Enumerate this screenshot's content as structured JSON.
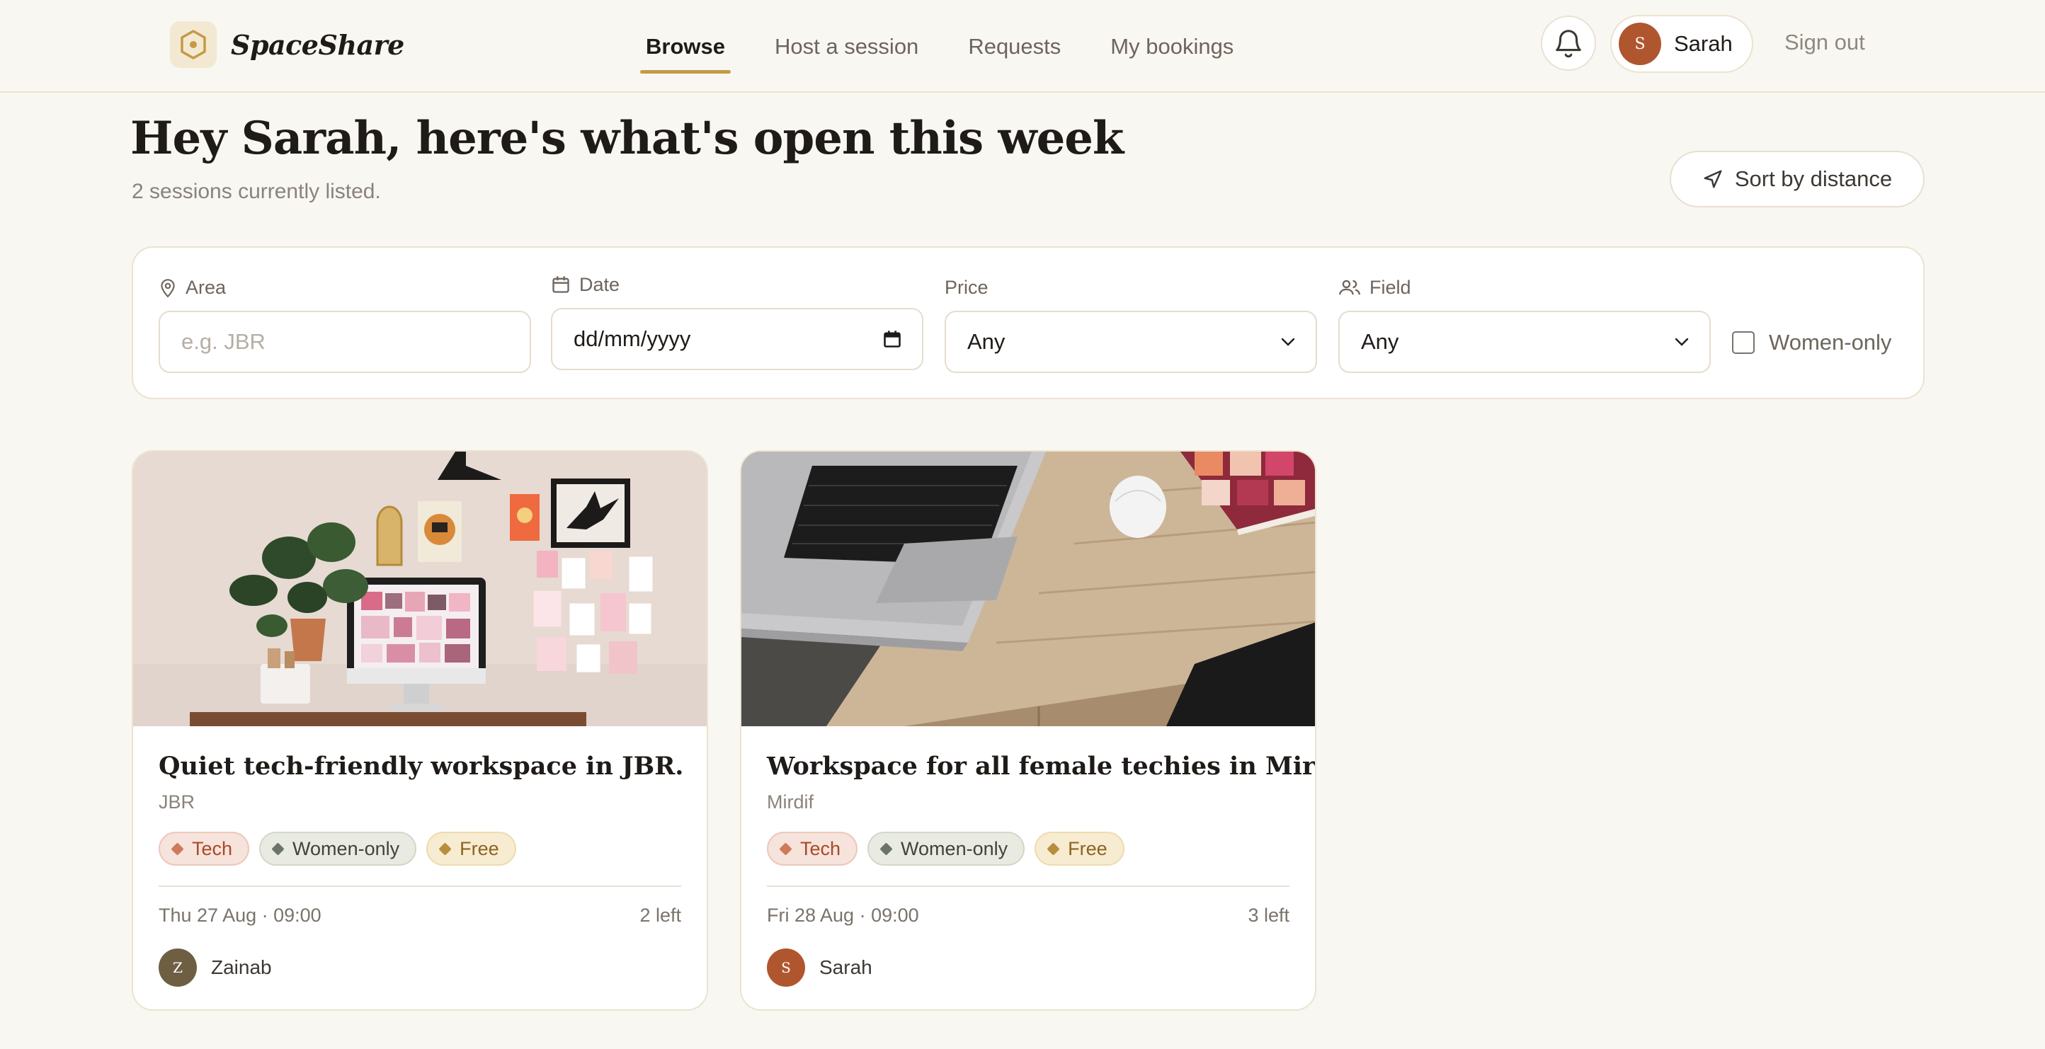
{
  "nav": {
    "brand": "SpaceShare",
    "links": [
      {
        "label": "Browse",
        "active": true
      },
      {
        "label": "Host a session",
        "active": false
      },
      {
        "label": "Requests",
        "active": false
      },
      {
        "label": "My bookings",
        "active": false
      }
    ],
    "user": {
      "initial": "S",
      "name": "Sarah"
    },
    "signout_label": "Sign out"
  },
  "header": {
    "title": "Hey Sarah, here's what's open this week",
    "subtitle": "2 sessions currently listed.",
    "sort_label": "Sort by distance"
  },
  "filters": {
    "area": {
      "label": "Area",
      "placeholder": "e.g. JBR"
    },
    "date": {
      "label": "Date",
      "value": "dd/mm/yyyy"
    },
    "price": {
      "label": "Price",
      "value": "Any"
    },
    "field": {
      "label": "Field",
      "value": "Any"
    },
    "women_only": {
      "label": "Women-only",
      "checked": false
    }
  },
  "listings": [
    {
      "title": "Quiet tech-friendly workspace in JBR.",
      "area": "JBR",
      "tags": [
        "Tech",
        "Women-only",
        "Free"
      ],
      "when": "Thu 27 Aug · 09:00",
      "spots_left": "2 left",
      "host": {
        "initial": "Z",
        "name": "Zainab"
      },
      "image_icon": "desk-with-imac-and-plant-photo"
    },
    {
      "title": "Workspace for all female techies in Mirdif!!",
      "area": "Mirdif",
      "tags": [
        "Tech",
        "Women-only",
        "Free"
      ],
      "when": "Fri 28 Aug · 09:00",
      "spots_left": "3 left",
      "host": {
        "initial": "S",
        "name": "Sarah"
      },
      "image_icon": "laptop-on-wooden-desk-photo"
    }
  ],
  "colors": {
    "background": "#f9f7f2",
    "accent": "#c59a45",
    "user_avatar": "#b0562e",
    "host_zainab_avatar": "#6e5f43"
  }
}
